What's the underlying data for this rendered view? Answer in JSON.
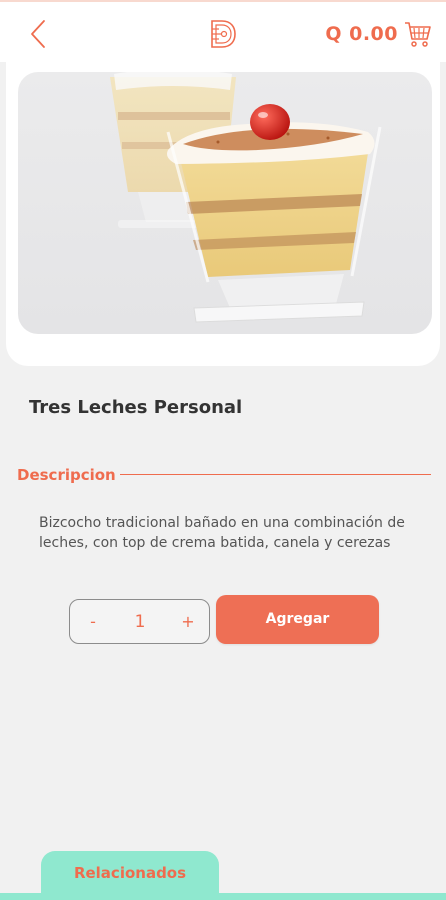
{
  "header": {
    "cart_total": "Q 0.00",
    "back_icon": "chevron-left-icon",
    "logo_icon": "brand-logo-icon",
    "cart_icon": "shopping-cart-icon"
  },
  "product": {
    "title": "Tres Leches Personal",
    "image_alt": "tres-leches-cake-cup-photo"
  },
  "description": {
    "label": "Descripcion",
    "text": "Bizcocho tradicional bañado en una combinación de leches, con top de crema batida, canela y cerezas"
  },
  "stepper": {
    "minus": "-",
    "quantity": "1",
    "plus": "+"
  },
  "actions": {
    "add_label": "Agregar"
  },
  "tabs": {
    "related_label": "Relacionados"
  },
  "colors": {
    "accent": "#ef6c4e",
    "background": "#f1f1f1",
    "mint": "#8fe8cf"
  }
}
